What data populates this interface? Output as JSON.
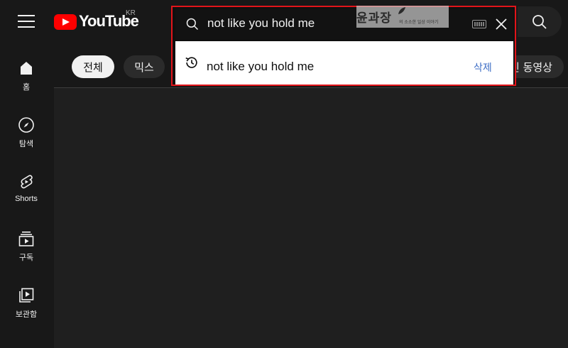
{
  "header": {
    "logo_text": "YouTube",
    "region": "KR"
  },
  "search": {
    "query": "not like you hold me",
    "suggestions": [
      {
        "text": "not like you hold me",
        "action": "삭제",
        "type": "history"
      }
    ]
  },
  "nav": {
    "items": [
      {
        "label": "홈",
        "icon": "home-icon"
      },
      {
        "label": "탐색",
        "icon": "compass-icon"
      },
      {
        "label": "Shorts",
        "icon": "shorts-icon"
      },
      {
        "label": "구독",
        "icon": "subscriptions-icon"
      },
      {
        "label": "보관함",
        "icon": "library-icon"
      }
    ]
  },
  "chips": [
    {
      "label": "전체",
      "active": true
    },
    {
      "label": "믹스",
      "active": false
    },
    {
      "label": "최근에 업로드된 동영상",
      "visible_text": "린 동영상",
      "active": false
    }
  ],
  "watermark": {
    "main": "윤과장",
    "sub": "의 소소한 일상 이야기"
  },
  "colors": {
    "brand_red": "#ff0000",
    "highlight_border": "#e2141a",
    "link_blue": "#3e6ec5",
    "background": "#181818"
  }
}
